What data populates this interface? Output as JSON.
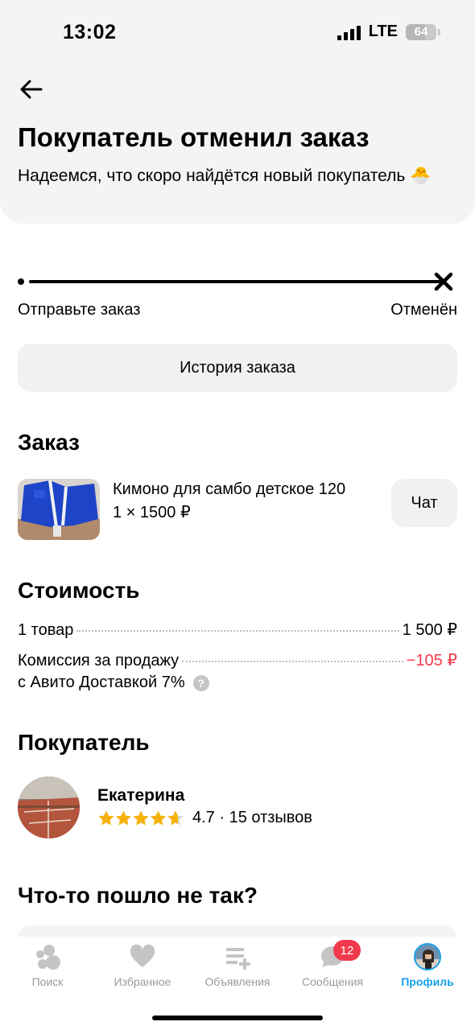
{
  "status_bar": {
    "time": "13:02",
    "network": "LTE",
    "battery": "64"
  },
  "header": {
    "title": "Покупатель отменил заказ",
    "subtitle": "Надеемся, что скоро найдётся новый покупатель 🐣"
  },
  "progress": {
    "start_label": "Отправьте заказ",
    "end_label": "Отменён"
  },
  "history_button": "История заказа",
  "order": {
    "heading": "Заказ",
    "product_name": "Кимоно для самбо детское 120",
    "quantity_price": "1 × 1500 ₽",
    "chat_button": "Чат",
    "image_icon": "kimono-photo"
  },
  "cost": {
    "heading": "Стоимость",
    "items_label": "1 товар",
    "items_value": "1 500 ₽",
    "fee_label_line1": "Комиссия за продажу",
    "fee_label_line2": "с Авито Доставкой 7%",
    "fee_value": "−105 ₽",
    "help_icon": "?"
  },
  "buyer": {
    "heading": "Покупатель",
    "name": "Екатерина",
    "rating": 4.7,
    "rating_text": "4.7 · 15 отзывов"
  },
  "problem": {
    "heading": "Что-то пошло не так?"
  },
  "tabbar": {
    "tabs": [
      {
        "label": "Поиск",
        "icon": "search-icon"
      },
      {
        "label": "Избранное",
        "icon": "heart-icon"
      },
      {
        "label": "Объявления",
        "icon": "listings-icon"
      },
      {
        "label": "Сообщения",
        "icon": "messages-icon",
        "badge": "12"
      },
      {
        "label": "Профиль",
        "icon": "profile-avatar",
        "active": true
      }
    ]
  },
  "colors": {
    "accent": "#14a0e8",
    "negative": "#f2394b",
    "star": "#f6b20b",
    "surface": "#f4f4f2"
  }
}
